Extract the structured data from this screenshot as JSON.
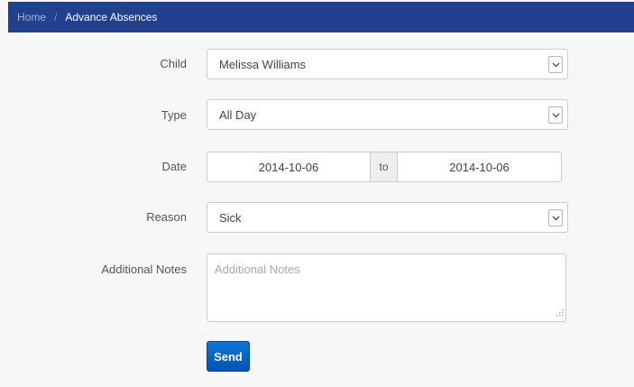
{
  "breadcrumb": {
    "home": "Home",
    "separator": "/",
    "current": "Advance Absences"
  },
  "form": {
    "child": {
      "label": "Child",
      "value": "Melissa Williams"
    },
    "type": {
      "label": "Type",
      "value": "All Day"
    },
    "date": {
      "label": "Date",
      "from": "2014-10-06",
      "to_label": "to",
      "to": "2014-10-06"
    },
    "reason": {
      "label": "Reason",
      "value": "Sick"
    },
    "notes": {
      "label": "Additional Notes",
      "placeholder": "Additional Notes"
    },
    "send_label": "Send"
  },
  "colors": {
    "header": "#21408d",
    "button": "#0a63c6"
  },
  "icons": {
    "dropdown": "chevron-down-icon",
    "resize": "resize-grip-icon"
  }
}
